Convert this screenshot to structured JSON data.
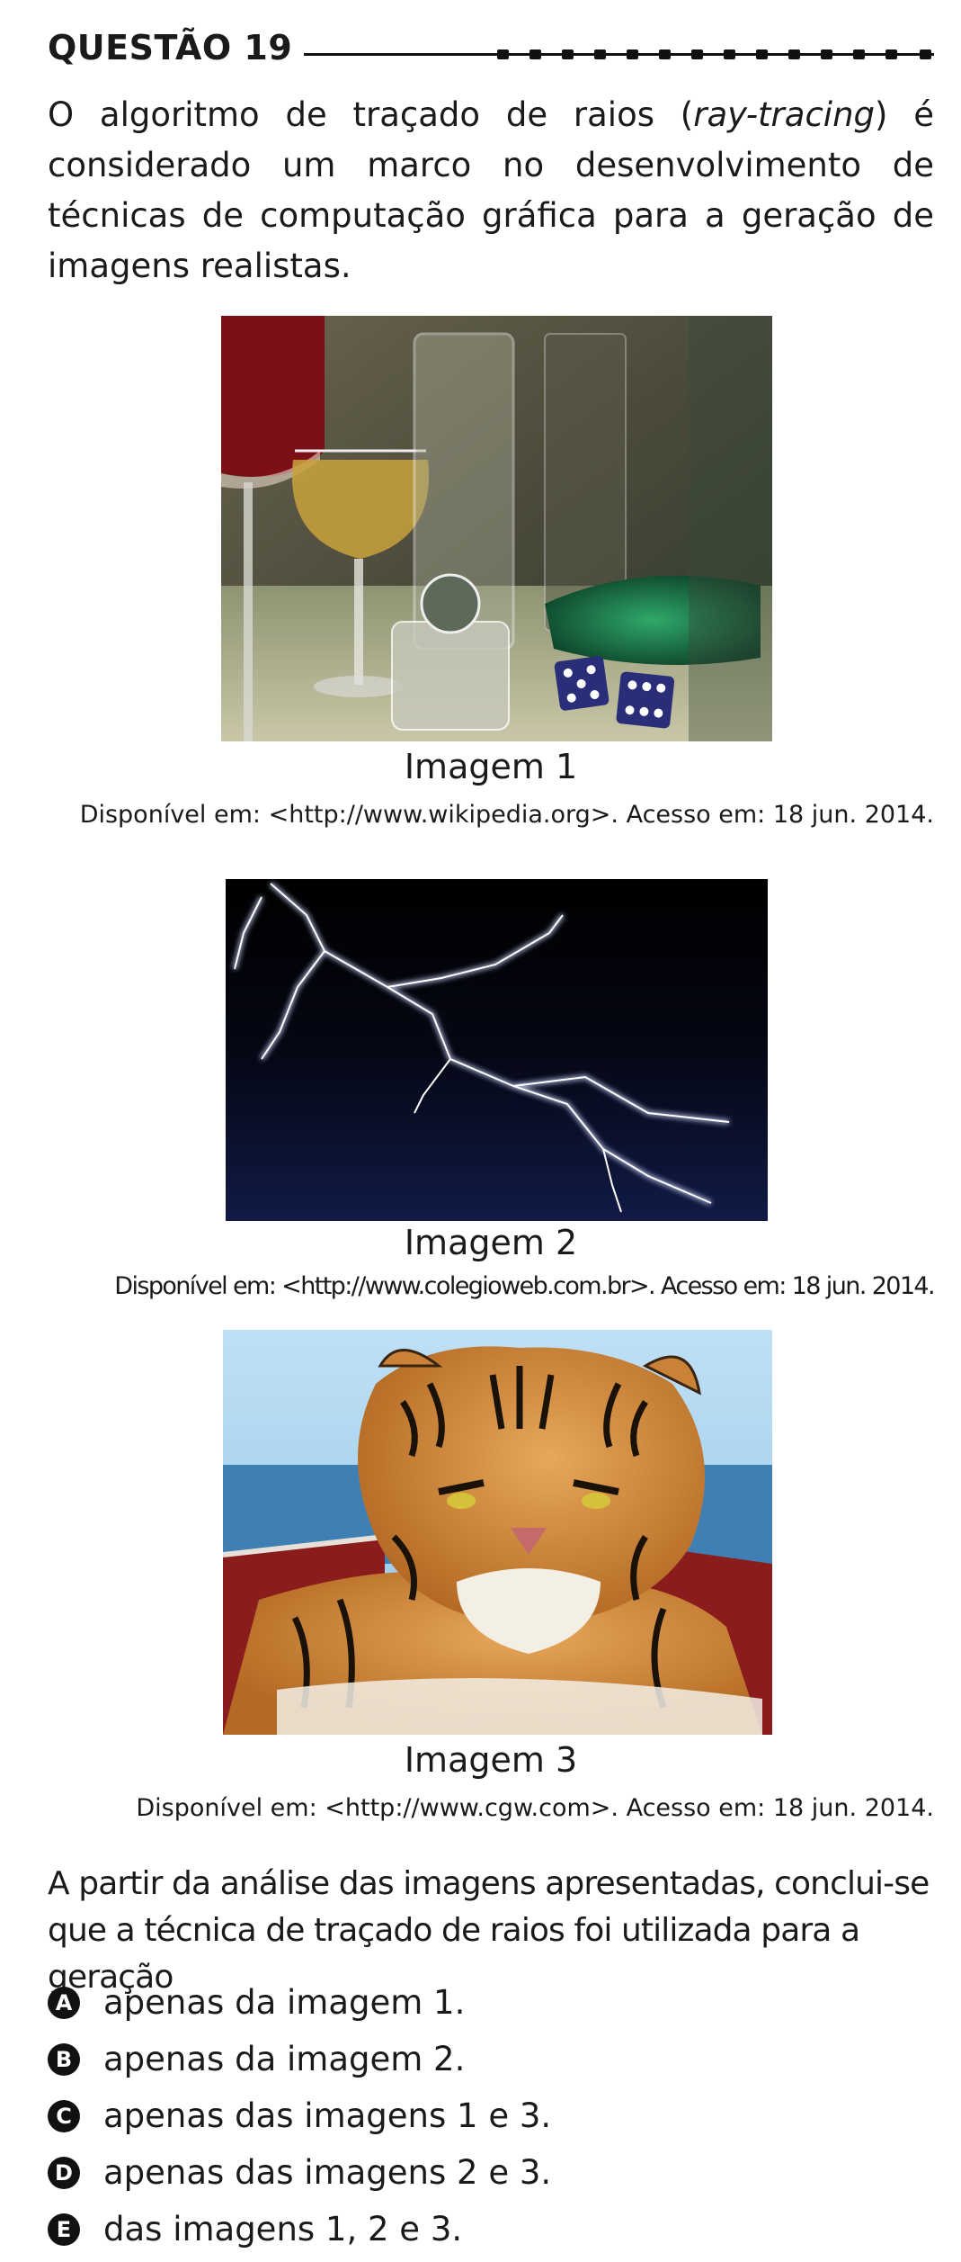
{
  "question": {
    "title": "QUESTÃO 19",
    "intro_before": "O algoritmo de traçado de raios (",
    "intro_italic": "ray-tracing",
    "intro_after": ") é considerado um marco no desenvolvimento de técnicas de computação gráfica para a geração de imagens realistas.",
    "prompt": "A partir da análise das imagens apresentadas, conclui-se que a técnica de traçado de raios foi utilizada para a geração"
  },
  "figures": [
    {
      "label": "Imagem 1",
      "source": "Disponível em: <http://www.wikipedia.org>. Acesso em: 18 jun. 2014.",
      "icon": "glasses-dice-render-image"
    },
    {
      "label": "Imagem 2",
      "source": "Disponível em: <http://www.colegioweb.com.br>. Acesso em: 18 jun. 2014.",
      "icon": "lightning-image"
    },
    {
      "label": "Imagem 3",
      "source": "Disponível em: <http://www.cgw.com>. Acesso em: 18 jun. 2014.",
      "icon": "tiger-image"
    }
  ],
  "options": [
    {
      "letter": "A",
      "text": "apenas da imagem 1."
    },
    {
      "letter": "B",
      "text": "apenas da imagem 2."
    },
    {
      "letter": "C",
      "text": "apenas das imagens 1 e 3."
    },
    {
      "letter": "D",
      "text": "apenas das imagens 2 e 3."
    },
    {
      "letter": "E",
      "text": "das imagens 1, 2 e 3."
    }
  ]
}
